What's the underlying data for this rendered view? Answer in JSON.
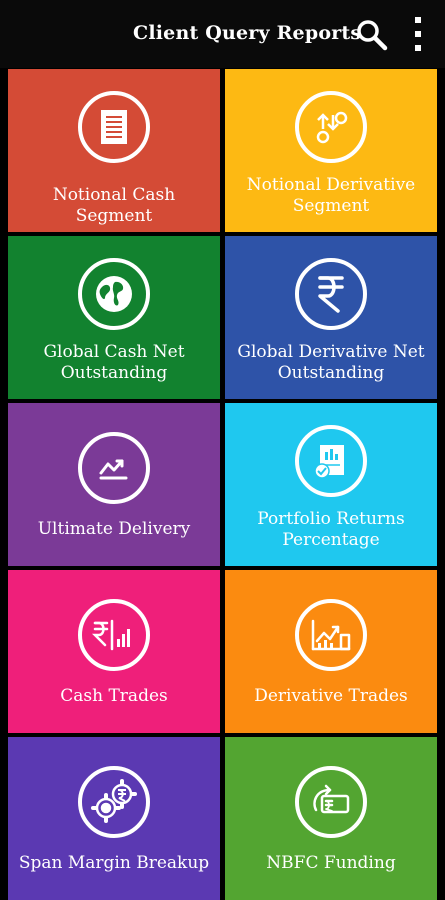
{
  "header": {
    "title": "Client Query Reports",
    "search_icon": "search-icon",
    "menu_icon": "more-vert-icon"
  },
  "tiles": [
    {
      "label": "Notional Cash Segment",
      "icon": "document-icon",
      "color": "#d44b36"
    },
    {
      "label": "Notional Derivative Segment",
      "icon": "derivative-icon",
      "color": "#fdb913"
    },
    {
      "label": "Global Cash Net Outstanding",
      "icon": "globe-icon",
      "color": "#12822f"
    },
    {
      "label": "Global Derivative Net Outstanding",
      "icon": "rupee-icon",
      "color": "#2e53a8"
    },
    {
      "label": "Ultimate Delivery",
      "icon": "trend-icon",
      "color": "#7b3a97"
    },
    {
      "label": "Portfolio Returns Percentage",
      "icon": "portfolio-report-icon",
      "color": "#1fc8ef"
    },
    {
      "label": "Cash Trades",
      "icon": "rupee-bars-icon",
      "color": "#ef1f7a"
    },
    {
      "label": "Derivative Trades",
      "icon": "growth-chart-icon",
      "color": "#fb8b10"
    },
    {
      "label": "Span Margin Breakup",
      "icon": "gears-rupee-icon",
      "color": "#5b39b2"
    },
    {
      "label": "NBFC Funding",
      "icon": "card-transfer-icon",
      "color": "#53a531"
    }
  ]
}
